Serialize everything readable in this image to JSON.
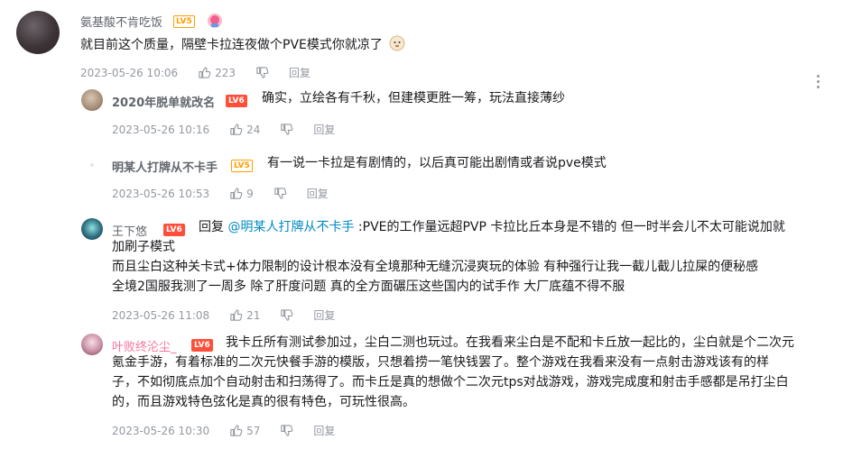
{
  "main": {
    "user": "氨基酸不肯吃饭",
    "level": "LV5",
    "text": "就目前这个质量，隔壁卡拉连夜做个PVE模式你就凉了",
    "emoji": "dog-face-emoji",
    "time": "2023-05-26 10:06",
    "likes": "223",
    "reply": "回复"
  },
  "replies": [
    {
      "user": "2020年脱单就改名",
      "level": "LV6",
      "text": "确实，立绘各有千秋，但建模更胜一筹，玩法直接薄纱",
      "time": "2023-05-26 10:16",
      "likes": "24",
      "reply": "回复"
    },
    {
      "user": "明某人打牌从不卡手",
      "level": "LV5",
      "text": "有一说一卡拉是有剧情的，以后真可能出剧情或者说pve模式",
      "time": "2023-05-26 10:53",
      "likes": "9",
      "reply": "回复"
    },
    {
      "user": "王下悠",
      "level": "LV6",
      "reply_prefix": "回复",
      "mention": "@明某人打牌从不卡手",
      "lines": [
        ":PVE的工作量远超PVP 卡拉比丘本身是不错的 但一时半会儿不太可能说加就",
        "加刷子模式",
        "而且尘白这种关卡式+体力限制的设计根本没有全境那种无缝沉浸爽玩的体验 有种强行让我一截儿截儿拉屎的便秘感",
        "全境2国服我测了一周多 除了肝度问题 真的全方面碾压这些国内的试手作 大厂底蕴不得不服"
      ],
      "time": "2023-05-26 11:08",
      "likes": "21",
      "reply": "回复"
    },
    {
      "user": "叶败终沦尘_",
      "level": "LV6",
      "lines": [
        "我卡丘所有测试参加过，尘白二测也玩过。在我看来尘白是不配和卡丘放一起比的，尘白就是个二次元",
        "氪金手游，有着标准的二次元快餐手游的模版，只想着捞一笔快钱罢了。整个游戏在我看来没有一点射击游戏该有的样",
        "子，不如彻底点加个自动射击和扫荡得了。而卡丘是真的想做个二次元tps对战游戏，游戏完成度和射击手感都是吊打尘白",
        "的，而且游戏特色弦化是真的很有特色，可玩性很高。"
      ],
      "time": "2023-05-26 10:30",
      "likes": "57",
      "reply": "回复"
    }
  ],
  "colors": {
    "lv5": "#ff9e00",
    "lv6": "#ff4f3b",
    "link": "#008ac5",
    "pink_name": "#fb7299",
    "meta": "#9499a0"
  }
}
